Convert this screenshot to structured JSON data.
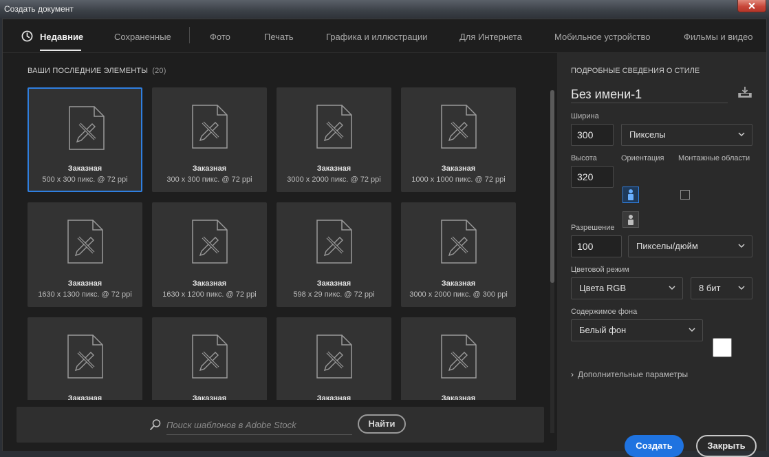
{
  "window": {
    "title": "Создать документ"
  },
  "tabs": [
    {
      "label": "Недавние",
      "active": true
    },
    {
      "label": "Сохраненные"
    },
    {
      "label": "Фото"
    },
    {
      "label": "Печать"
    },
    {
      "label": "Графика и иллюстрации"
    },
    {
      "label": "Для Интернета"
    },
    {
      "label": "Мобильное устройство"
    },
    {
      "label": "Фильмы и видео"
    }
  ],
  "recent": {
    "header": "ВАШИ ПОСЛЕДНИЕ ЭЛЕМЕНТЫ",
    "count": "(20)",
    "items": [
      {
        "name": "Заказная",
        "size": "500 x 300 пикс. @ 72 ppi",
        "selected": true
      },
      {
        "name": "Заказная",
        "size": "300 x 300 пикс. @ 72 ppi"
      },
      {
        "name": "Заказная",
        "size": "3000 x 2000 пикс. @ 72 ppi"
      },
      {
        "name": "Заказная",
        "size": "1000 x 1000 пикс. @ 72 ppi"
      },
      {
        "name": "Заказная",
        "size": "1630 x 1300 пикс. @ 72 ppi"
      },
      {
        "name": "Заказная",
        "size": "1630 x 1200 пикс. @ 72 ppi"
      },
      {
        "name": "Заказная",
        "size": "598 x 29 пикс. @ 72 ppi"
      },
      {
        "name": "Заказная",
        "size": "3000 x 2000 пикс. @ 300 ppi"
      },
      {
        "name": "Заказная",
        "size": ""
      },
      {
        "name": "Заказная",
        "size": ""
      },
      {
        "name": "Заказная",
        "size": ""
      },
      {
        "name": "Заказная",
        "size": ""
      }
    ]
  },
  "search": {
    "placeholder": "Поиск шаблонов в Adobe Stock",
    "button": "Найти"
  },
  "details": {
    "header": "ПОДРОБНЫЕ СВЕДЕНИЯ О СТИЛЕ",
    "doc_name": "Без имени-1",
    "width_label": "Ширина",
    "width_value": "300",
    "width_unit": "Пикселы",
    "height_label": "Высота",
    "height_value": "320",
    "orientation_label": "Ориентация",
    "artboards_label": "Монтажные области",
    "resolution_label": "Разрешение",
    "resolution_value": "100",
    "resolution_unit": "Пикселы/дюйм",
    "color_mode_label": "Цветовой режим",
    "color_mode": "Цвета RGB",
    "bit_depth": "8 бит",
    "bg_label": "Содержимое фона",
    "bg_value": "Белый фон",
    "bg_color": "#ffffff",
    "advanced": "Дополнительные параметры"
  },
  "actions": {
    "create": "Создать",
    "close": "Закрыть"
  },
  "colors": {
    "accent": "#1f73e0",
    "selection": "#2f7fe0"
  }
}
